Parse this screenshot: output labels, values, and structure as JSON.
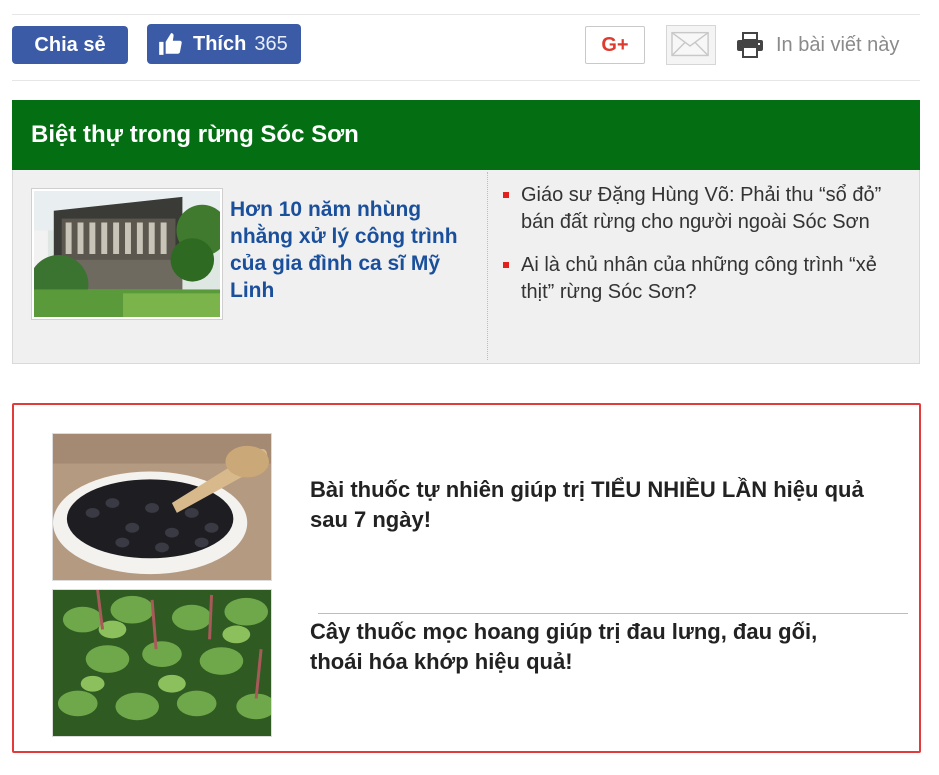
{
  "share_bar": {
    "share_label": "Chia sẻ",
    "like_label": "Thích",
    "like_count": "365",
    "gplus_label": "G+",
    "print_label": "In bài viết này"
  },
  "related": {
    "header": "Biệt thự trong rừng Sóc Sơn",
    "featured_title": "Hơn 10 năm nhùng nhằng xử lý công trình của gia đình ca sĩ Mỹ Linh",
    "links": [
      "Giáo sư Đặng Hùng Võ: Phải thu “sổ đỏ” bán đất rừng cho người ngoài Sóc Sơn",
      "Ai là chủ nhân của những công trình “xẻ thịt” rừng Sóc Sơn?"
    ]
  },
  "ads": [
    {
      "title": "Bài thuốc tự nhiên giúp trị TIỂU NHIỀU LẦN hiệu quả sau 7 ngày!"
    },
    {
      "title": "Cây thuốc mọc hoang giúp trị đau lưng, đau gối, thoái hóa khớp hiệu quả!"
    }
  ],
  "colors": {
    "facebook_blue": "#3b5ba7",
    "header_green": "#046f12",
    "link_blue": "#1a4f9c",
    "bullet_red": "#e2211c",
    "ad_border": "#e23b3b"
  },
  "icons": [
    "thumbs-up-icon",
    "mail-icon",
    "printer-icon"
  ]
}
